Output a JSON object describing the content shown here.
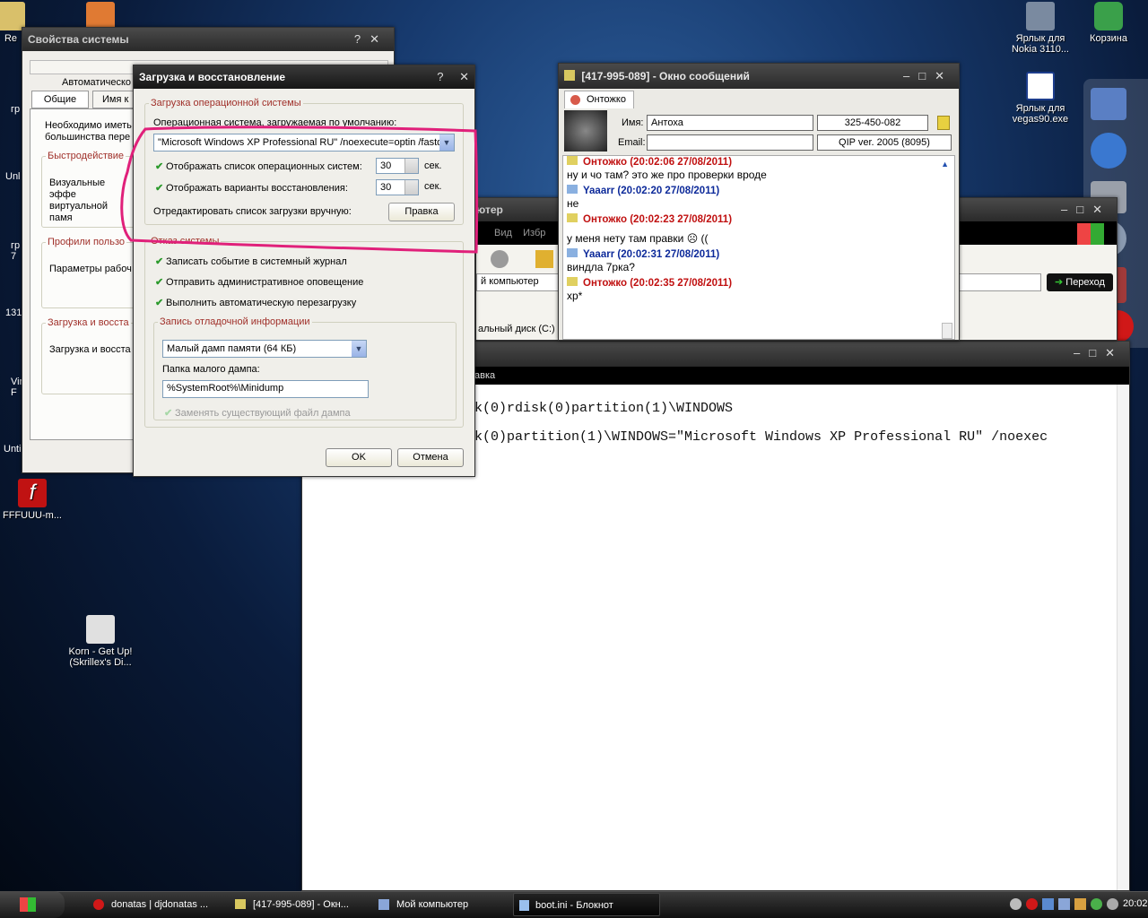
{
  "desktop": {
    "icons": [
      {
        "label": "Re",
        "color": "#d9c06a"
      },
      {
        "label": "",
        "color": "#e07a33"
      },
      {
        "label": "Ярлык для Nokia 3110...",
        "color": "#7a8aa0"
      },
      {
        "label": "Корзина",
        "color": "#3aa04a"
      },
      {
        "label": "Ярлык для vegas90.exe",
        "color": "#ffffff"
      },
      {
        "label": "FFFUUU-m...",
        "color": "#c01212"
      },
      {
        "label": "Korn - Get Up! (Skrillex's Di...",
        "color": "#e0e0e0"
      }
    ],
    "side_labels": [
      "гр",
      "Unl",
      "гр 7",
      "131",
      "Vir F",
      "Unti"
    ]
  },
  "sysprops": {
    "title": "Свойства системы",
    "tabs": [
      "Автоматическо",
      "Общие",
      "Имя к"
    ],
    "intro": "Необходимо иметь большинства пере",
    "groups": [
      {
        "legend": "Быстродействие",
        "text": "Визуальные эффе виртуальной памя"
      },
      {
        "legend": "Профили пользо",
        "text": "Параметры рабоч"
      },
      {
        "legend": "Загрузка и восста",
        "text": "Загрузка и восста"
      }
    ]
  },
  "boot": {
    "title": "Загрузка и восстановление",
    "help": "?",
    "close": "✕",
    "os_group": "Загрузка операционной системы",
    "default_os_label": "Операционная система, загружаемая по умолчанию:",
    "default_os_value": "\"Microsoft Windows XP Professional RU\" /noexecute=optin /fastd",
    "show_list_label": "Отображать список операционных систем:",
    "show_list_value": "30",
    "show_recovery_label": "Отображать варианты восстановления:",
    "show_recovery_value": "30",
    "sec": "сек.",
    "edit_label": "Отредактировать список загрузки вручную:",
    "edit_button": "Правка",
    "failure_group": "Отказ системы",
    "write_event": "Записать событие в системный журнал",
    "send_alert": "Отправить административное оповещение",
    "auto_restart": "Выполнить автоматическую перезагрузку",
    "debug_group": "Запись отладочной информации",
    "dump_type": "Малый дамп памяти (64 КБ)",
    "dump_folder_label": "Папка малого дампа:",
    "dump_folder": "%SystemRoot%\\Minidump",
    "overwrite": "Заменять существующий файл дампа",
    "ok": "OK",
    "cancel": "Отмена",
    "highlight_color": "#e0207a"
  },
  "qip": {
    "title": "[417-995-089] - Окно сообщений",
    "tab": "Онтожко",
    "name_label": "Имя:",
    "name_value": "Антоха",
    "uin": "325-450-082",
    "email_label": "Email:",
    "email_value": "",
    "client": "QIP ver. 2005 (8095)",
    "messages": [
      {
        "header": "Онтожко (20:02:06 27/08/2011)",
        "text": "ну и чо там? это же про проверки вроде",
        "who": "red"
      },
      {
        "header": "Yaaarr (20:02:20 27/08/2011)",
        "text": "не",
        "who": "blue"
      },
      {
        "header": "Онтожко (20:02:23 27/08/2011)",
        "text": "у меня нету там правки ☹ ((",
        "who": "red"
      },
      {
        "header": "Yaaarr (20:02:31 27/08/2011)",
        "text": "виндла 7рка?",
        "who": "blue"
      },
      {
        "header": "Онтожко (20:02:35 27/08/2011)",
        "text": "xp*",
        "who": "red"
      }
    ]
  },
  "explorer": {
    "title_fragment": "ютер",
    "menu": [
      "Вид",
      "Избр"
    ],
    "address": "й компьютер",
    "go": "Переход",
    "drive": "альный диск (C:)"
  },
  "notepad": {
    "menu_fragment": "авка",
    "line1": "k(0)rdisk(0)partition(1)\\WINDOWS",
    "line2": "k(0)partition(1)\\WINDOWS=\"Microsoft Windows XP Professional RU\" /noexec"
  },
  "taskbar": {
    "items": [
      {
        "label": "donatas | djdonatas ...",
        "icon": "opera-icon"
      },
      {
        "label": "[417-995-089] - Окн...",
        "icon": "qip-icon"
      },
      {
        "label": "Мой компьютер",
        "icon": "computer-icon"
      },
      {
        "label": "boot.ini - Блокнот",
        "icon": "notepad-icon"
      }
    ],
    "clock": "20:02"
  }
}
